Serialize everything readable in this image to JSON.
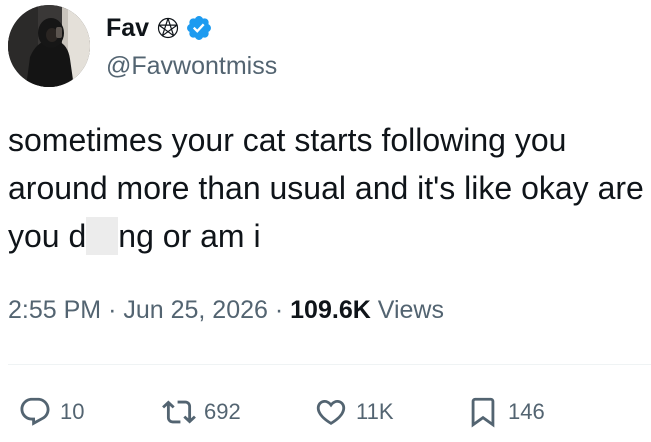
{
  "user": {
    "display_name": "Fav",
    "name_emoji": "✵",
    "handle": "@Favwontmiss",
    "verified": true,
    "verified_color": "#1d9bf0"
  },
  "tweet": {
    "text_before_censor": "sometimes your cat starts following you around more than usual and it's like okay are you d",
    "text_after_censor": "ng or am i"
  },
  "meta": {
    "time": "2:55 PM",
    "separator": "·",
    "date": "Jun 25, 2026",
    "views_count": "109.6K",
    "views_label": "Views"
  },
  "actions": {
    "reply": {
      "icon": "reply-icon",
      "count": "10"
    },
    "retweet": {
      "icon": "retweet-icon",
      "count": "692"
    },
    "like": {
      "icon": "heart-icon",
      "count": "11K"
    },
    "bookmark": {
      "icon": "bookmark-icon",
      "count": "146"
    }
  },
  "colors": {
    "text": "#0f1419",
    "secondary": "#536471",
    "divider": "#eff3f4"
  }
}
